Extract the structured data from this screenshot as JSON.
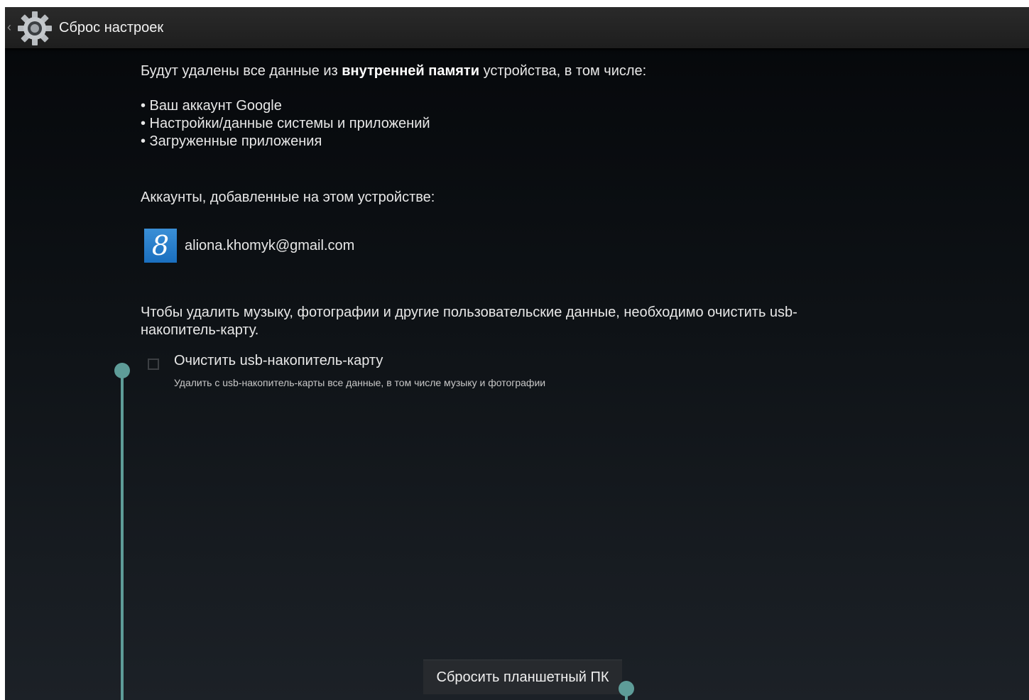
{
  "actionbar": {
    "back_icon": "‹",
    "title": "Сброс настроек",
    "app_icon": "settings-gear-icon"
  },
  "intro": {
    "before": "Будут удалены все данные из ",
    "bold": "внутренней памяти",
    "after": " устройства, в том числе:"
  },
  "bullets": [
    "• Ваш аккаунт Google",
    "• Настройки/данные системы и приложений",
    "• Загруженные приложения"
  ],
  "accounts": {
    "heading": "Аккаунты, добавленные на этом устройстве:",
    "email": "aliona.khomyk@gmail.com",
    "icon": "google-account-icon",
    "icon_glyph": "8"
  },
  "usb": {
    "info": "Чтобы удалить музыку, фотографии и другие пользовательские данные, необходимо очистить usb-накопитель-карту.",
    "checkbox_title": "Очистить usb-накопитель-карту",
    "checkbox_summary": "Удалить с usb-накопитель-карты все данные, в том числе музыку и фотографии",
    "checked": false
  },
  "reset_button": "Сбросить планшетный ПК",
  "colors": {
    "overlay": "#5e9c98",
    "google_blue": "#1a6fbf",
    "actionbar": "#222222"
  }
}
